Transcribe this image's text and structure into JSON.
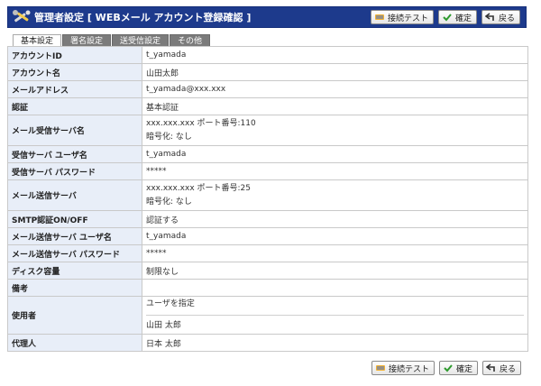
{
  "header": {
    "title": "管理者設定 [ WEBメール アカウント登録確認 ]",
    "buttons": {
      "test": "接続テスト",
      "confirm": "確定",
      "back": "戻る"
    }
  },
  "tabs": [
    {
      "label": "基本設定",
      "active": true
    },
    {
      "label": "署名設定",
      "active": false
    },
    {
      "label": "送受信設定",
      "active": false
    },
    {
      "label": "その他",
      "active": false
    }
  ],
  "rows": {
    "account_id": {
      "label": "アカウントID",
      "value": "t_yamada"
    },
    "account_name": {
      "label": "アカウント名",
      "value": "山田太郎"
    },
    "email": {
      "label": "メールアドレス",
      "value": "t_yamada@xxx.xxx"
    },
    "auth": {
      "label": "認証",
      "value": "基本認証"
    },
    "recv_server": {
      "label": "メール受信サーバ名",
      "value": "xxx.xxx.xxx ポート番号:110",
      "value2": "暗号化: なし"
    },
    "recv_user": {
      "label": "受信サーバ ユーザ名",
      "value": "t_yamada"
    },
    "recv_pass": {
      "label": "受信サーバ パスワード",
      "value": "*****"
    },
    "send_server": {
      "label": "メール送信サーバ",
      "value": "xxx.xxx.xxx ポート番号:25",
      "value2": "暗号化: なし"
    },
    "smtp_auth": {
      "label": "SMTP認証ON/OFF",
      "value": "認証する"
    },
    "send_user": {
      "label": "メール送信サーバ ユーザ名",
      "value": "t_yamada"
    },
    "send_pass": {
      "label": "メール送信サーバ パスワード",
      "value": "*****"
    },
    "disk": {
      "label": "ディスク容量",
      "value": "制限なし"
    },
    "note": {
      "label": "備考",
      "value": ""
    },
    "users": {
      "label": "使用者",
      "value": "ユーザを指定",
      "value2": "山田 太郎"
    },
    "proxy": {
      "label": "代理人",
      "value": "日本 太郎"
    }
  },
  "colors": {
    "title_bar": "#1d3a8c",
    "label_bg": "#e8eef8",
    "tab_inactive": "#7b7b7b"
  },
  "icons": {
    "title": "tools-icon",
    "test": "connection-test-icon",
    "confirm": "check-icon",
    "back": "back-arrow-icon"
  }
}
